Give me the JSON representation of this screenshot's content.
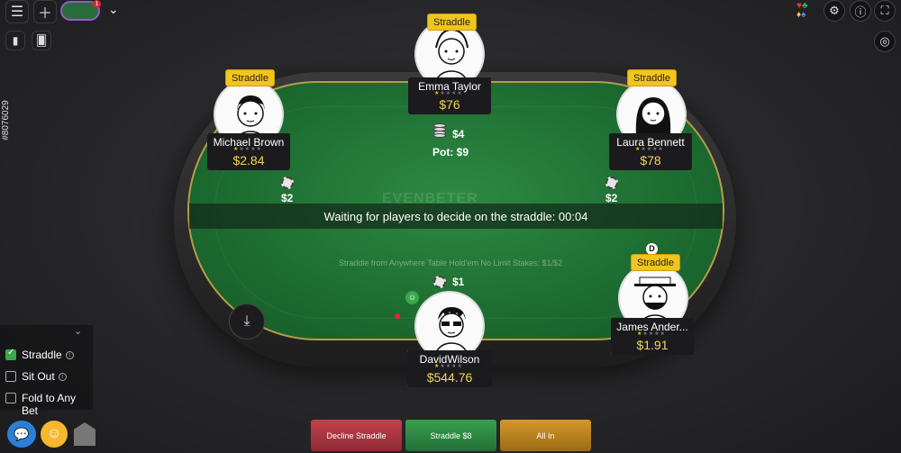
{
  "table_id": "#8076029",
  "watermark": "EVENBETER",
  "banner": "Waiting for players to decide on the straddle: 00:04",
  "stakes_line": "Straddle from Anywhere Table Hold'em No Limit Stakes: $1/$2",
  "pot": {
    "center_bet": "$4",
    "total": "Pot: $9"
  },
  "straddle_badge": "Straddle",
  "dealer_button": "D",
  "top_toolbar": {
    "tab_badge": "1"
  },
  "players": [
    {
      "name": "Emma Taylor",
      "stack": "$76",
      "straddle": true
    },
    {
      "name": "Michael Brown",
      "stack": "$2.84",
      "straddle": true,
      "bet": "$2"
    },
    {
      "name": "Laura Bennett",
      "stack": "$78",
      "straddle": true,
      "bet": "$2"
    },
    {
      "name": "James Ander...",
      "stack": "$1.91",
      "straddle": true,
      "dealer": true
    },
    {
      "name": "DavidWilson",
      "stack": "$544.76",
      "straddle": false,
      "bet": "$1",
      "hero": true
    }
  ],
  "side_panel": {
    "options": [
      {
        "label": "Straddle",
        "checked": true,
        "info": true
      },
      {
        "label": "Sit Out",
        "checked": false,
        "info": true
      },
      {
        "label": "Fold to Any Bet",
        "checked": false,
        "info": false
      }
    ]
  },
  "actions": {
    "decline": "Decline Straddle",
    "straddle": "Straddle $8",
    "allin": "All In"
  },
  "colors": {
    "felt": "#1e6e32",
    "accent_purple": "#8a4bb3",
    "straddle_yellow": "#f2c51d",
    "stack_gold": "#f3d45a",
    "decline": "#b23a45",
    "straddle_btn": "#2f8f45",
    "allin": "#c28a22"
  }
}
